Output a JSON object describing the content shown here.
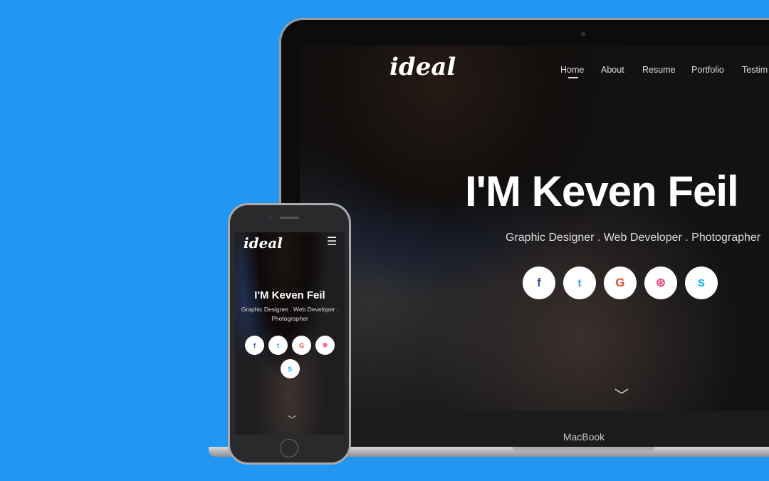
{
  "laptop": {
    "brand_label": "MacBook"
  },
  "site": {
    "logo": "ideal",
    "nav": [
      "Home",
      "About",
      "Resume",
      "Portfolio",
      "Testim"
    ],
    "active_nav": "Home",
    "title": "I'M Keven Feil",
    "subtitle": "Graphic Designer . Web Developer . Photographer",
    "mobile_subtitle_line1": "Graphic Designer . Web Developer .",
    "mobile_subtitle_line2": "Photographer",
    "social": [
      {
        "icon": "facebook-icon",
        "glyph": "f",
        "color": "#3b5998"
      },
      {
        "icon": "twitter-icon",
        "glyph": "t",
        "color": "#1da1f2"
      },
      {
        "icon": "google-icon",
        "glyph": "G",
        "color": "#dd4b39"
      },
      {
        "icon": "dribbble-icon",
        "glyph": "⊛",
        "color": "#ea4c89"
      },
      {
        "icon": "skype-icon",
        "glyph": "S",
        "color": "#00aff0"
      }
    ],
    "scroll_glyph": "﹀",
    "menu_glyph": "☰"
  },
  "colors": {
    "background": "#2196f3"
  }
}
